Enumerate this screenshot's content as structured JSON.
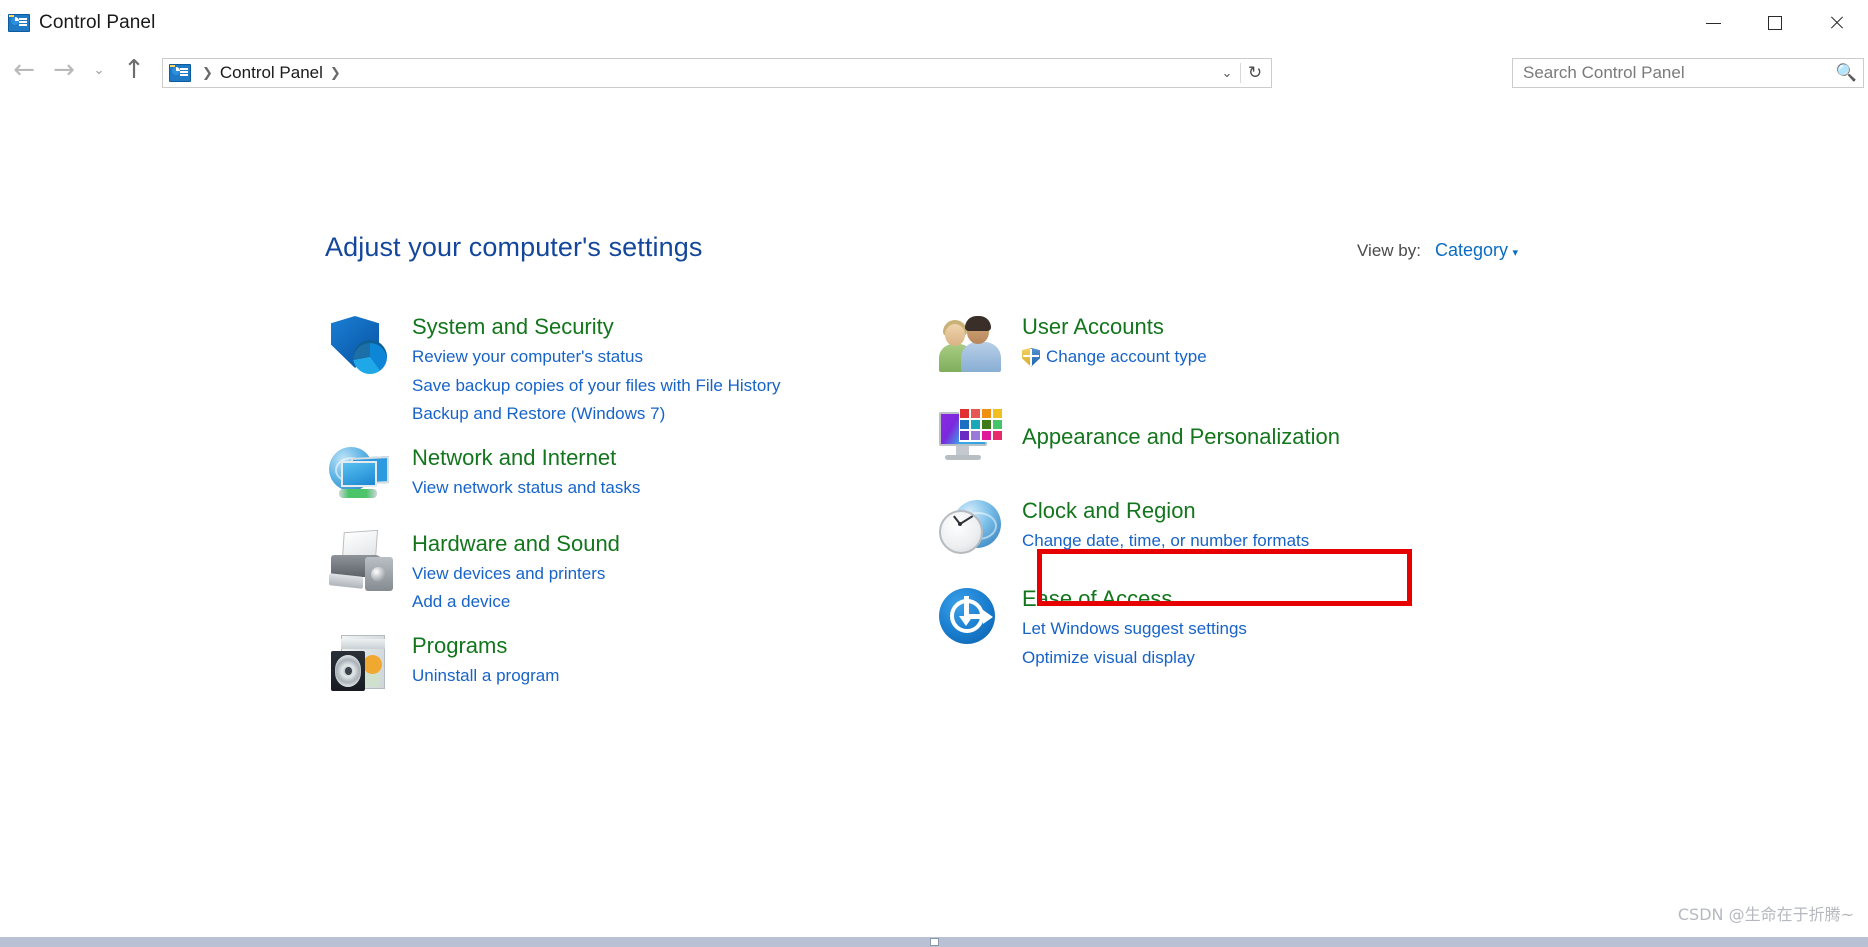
{
  "window": {
    "title": "Control Panel",
    "icon": "control-panel-icon",
    "controls": {
      "minimize": "—",
      "maximize": "□",
      "close": "✕"
    }
  },
  "nav": {
    "back": "←",
    "forward": "→",
    "recent": "⌄",
    "up": "↑",
    "breadcrumb": {
      "icon": "control-panel-icon",
      "separator_1": "❯",
      "text": "Control Panel",
      "separator_2": "❯"
    },
    "dropdown": "⌄",
    "refresh": "↻"
  },
  "search": {
    "placeholder": "Search Control Panel",
    "value": "",
    "icon": "search-icon"
  },
  "main": {
    "page_title": "Adjust your computer's settings",
    "view_by": {
      "label": "View by:",
      "value": "Category",
      "caret": "▾"
    }
  },
  "categories": {
    "left": [
      {
        "icon": "shield-security-icon",
        "title": "System and Security",
        "links": [
          "Review your computer's status",
          "Save backup copies of your files with File History",
          "Backup and Restore (Windows 7)"
        ]
      },
      {
        "icon": "network-globe-icon",
        "title": "Network and Internet",
        "links": [
          "View network status and tasks"
        ]
      },
      {
        "icon": "printer-icon",
        "title": "Hardware and Sound",
        "links": [
          "View devices and printers",
          "Add a device"
        ]
      },
      {
        "icon": "programs-disc-icon",
        "title": "Programs",
        "links": [
          "Uninstall a program"
        ]
      }
    ],
    "right": [
      {
        "icon": "user-accounts-icon",
        "title": "User Accounts",
        "links": [
          "Change account type"
        ],
        "shield_link": true
      },
      {
        "icon": "appearance-monitor-icon",
        "title": "Appearance and Personalization",
        "links": []
      },
      {
        "icon": "clock-region-icon",
        "title": "Clock and Region",
        "links": [
          "Change date, time, or number formats"
        ],
        "highlighted_link": "Change date, time, or number formats"
      },
      {
        "icon": "ease-of-access-icon",
        "title": "Ease of Access",
        "links": [
          "Let Windows suggest settings",
          "Optimize visual display"
        ]
      }
    ]
  },
  "annotation": {
    "highlight_color": "#e60000",
    "highlight_target": "Change date, time, or number formats"
  },
  "watermark": "CSDN @生命在于折腾~",
  "colors": {
    "category_title": "#13761d",
    "link": "#1763c8",
    "page_title": "#14479c",
    "accent": "#0a6cc4",
    "highlight": "#e60000",
    "statusbar": "#b9c2d4"
  }
}
